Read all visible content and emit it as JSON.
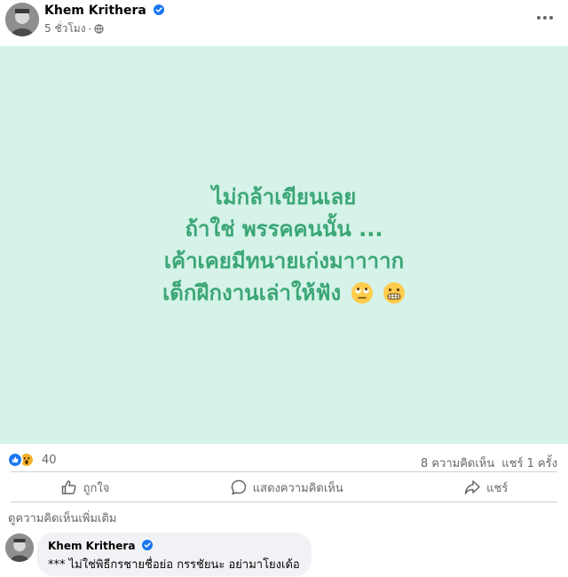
{
  "post": {
    "author": "Khem Krithera",
    "timestamp": "5 ชั่วโมง",
    "separator": "·",
    "privacy_icon": "globe-icon",
    "background_color": "#d5f3e8",
    "text_color": "#3ba676",
    "lines": [
      "ไม่กล้าเขียนเลย",
      "ถ้าใช่ พรรคคนนั้น ...",
      "เค้าเคยมีทนายเก่งมาาาาก",
      "เด็กฝึกงานเล่าให้ฟัง"
    ],
    "emojis": [
      "face-with-rolling-eyes",
      "grimacing-face"
    ]
  },
  "reactions": {
    "icons": [
      "like-icon",
      "wow-icon"
    ],
    "count": "40",
    "comments": "8 ความคิดเห็น",
    "shares": "แชร์ 1 ครั้ง"
  },
  "actions": {
    "like_label": "ถูกใจ",
    "comment_label": "แสดงความคิดเห็น",
    "share_label": "แชร์"
  },
  "comments_section": {
    "more_comments_label": "ดูความคิดเห็นเพิ่มเติม",
    "items": [
      {
        "author": "Khem Krithera",
        "text": "*** ไม่ใช่พิธีกรชายชื่อย่อ กรรชัยนะ อย่ามาโยงเด้อ"
      }
    ]
  },
  "colors": {
    "accent": "#1877f2",
    "muted_text": "#65676b"
  }
}
